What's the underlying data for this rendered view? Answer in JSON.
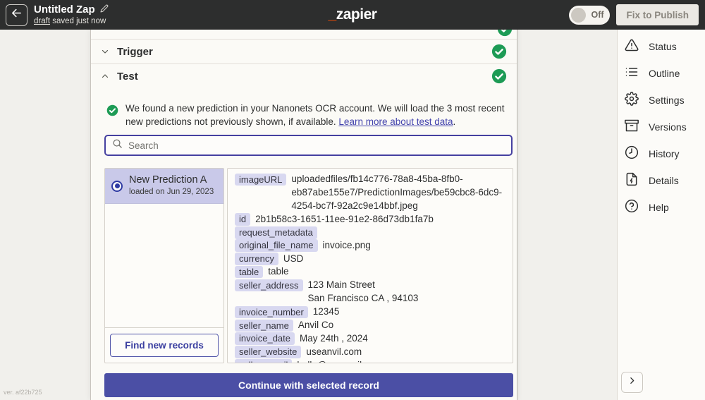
{
  "header": {
    "title": "Untitled Zap",
    "draft_label": "draft",
    "saved_text": " saved just now",
    "logo_underscore": "_",
    "logo_text": "zapier",
    "toggle_label": "Off",
    "publish_button": "Fix to Publish"
  },
  "panel": {
    "trigger_label": "Trigger",
    "test_label": "Test",
    "message": {
      "before_link": "We found a new prediction in your Nanonets OCR account. We will load the 3 most recent new predictions not previously shown, if available. ",
      "link": "Learn more about test data",
      "after_link": "."
    },
    "search_placeholder": "Search",
    "record_list": {
      "selected_title": "New Prediction A",
      "selected_subtitle": "loaded on Jun 29, 2023",
      "find_button": "Find new records"
    },
    "record_detail": {
      "fields": [
        {
          "key": "imageURL",
          "value": "uploadedfiles/fb14c776-78a8-45ba-8fb0-eb87abe155e7/PredictionImages/be59cbc8-6dc9-4254-bc7f-92a2c9e14bbf.jpeg"
        },
        {
          "key": "id",
          "value": "2b1b58c3-1651-11ee-91e2-86d73db1fa7b"
        },
        {
          "key": "request_metadata",
          "value": ""
        },
        {
          "key": "original_file_name",
          "value": "invoice.png"
        },
        {
          "key": "currency",
          "value": "USD"
        },
        {
          "key": "table",
          "value": "table"
        },
        {
          "key": "seller_address",
          "value": "123 Main Street\nSan Francisco CA , 94103"
        },
        {
          "key": "invoice_number",
          "value": "12345"
        },
        {
          "key": "seller_name",
          "value": "Anvil Co"
        },
        {
          "key": "invoice_date",
          "value": "May 24th , 2024"
        },
        {
          "key": "seller_website",
          "value": "useanvil.com"
        },
        {
          "key": "seller_email",
          "value": "hello@useanvil.com"
        }
      ]
    },
    "continue_button": "Continue with selected record"
  },
  "sidebar": {
    "items": [
      {
        "label": "Status",
        "icon": "alert-triangle-icon"
      },
      {
        "label": "Outline",
        "icon": "list-icon"
      },
      {
        "label": "Settings",
        "icon": "gear-icon"
      },
      {
        "label": "Versions",
        "icon": "archive-box-icon"
      },
      {
        "label": "History",
        "icon": "clock-icon"
      },
      {
        "label": "Details",
        "icon": "file-lightning-icon"
      },
      {
        "label": "Help",
        "icon": "help-circle-icon"
      }
    ]
  },
  "footer": {
    "version": "ver. af22b725"
  },
  "colors": {
    "header_bg": "#2d2e2e",
    "brand_orange": "#ff4f00",
    "success_green": "#1d9b55",
    "accent_indigo": "#4540a0",
    "cta_indigo": "#4b4fa5",
    "selected_lavender": "#c9c9e9",
    "pill_lavender": "#d8d8f0"
  }
}
